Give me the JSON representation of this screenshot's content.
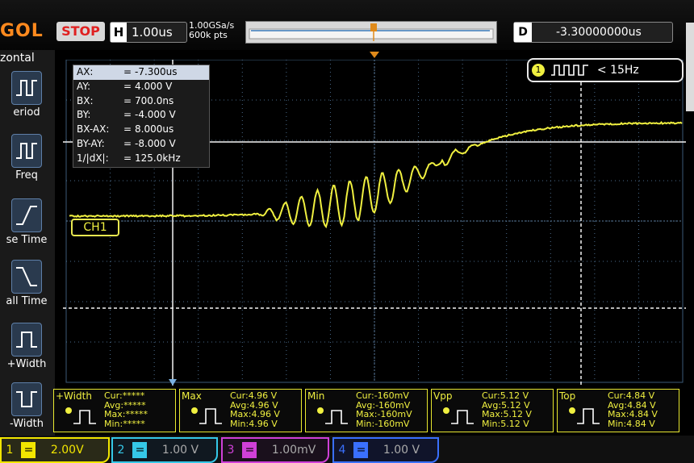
{
  "brand": "GOL",
  "run_state": "STOP",
  "timebase": {
    "label": "H",
    "value": "1.00us"
  },
  "sample": {
    "rate": "1.00GSa/s",
    "points": "600k pts"
  },
  "delay": {
    "label": "D",
    "value": "-3.30000000us"
  },
  "left_menu": {
    "header": "zontal",
    "items": [
      {
        "label": "eriod",
        "icon": "period-icon"
      },
      {
        "label": "Freq",
        "icon": "frequency-icon"
      },
      {
        "label": "se Time",
        "icon": "rise-time-icon"
      },
      {
        "label": "all Time",
        "icon": "fall-time-icon"
      },
      {
        "label": "+Width",
        "icon": "positive-width-icon"
      },
      {
        "label": "-Width",
        "icon": "negative-width-icon"
      }
    ]
  },
  "cursors": [
    {
      "name": "AX:",
      "eq": "=",
      "value": "-7.300us"
    },
    {
      "name": "AY:",
      "eq": "=",
      "value": "4.000 V"
    },
    {
      "name": "BX:",
      "eq": "=",
      "value": "700.0ns"
    },
    {
      "name": "BY:",
      "eq": "=",
      "value": "-4.000 V"
    },
    {
      "name": "BX-AX:",
      "eq": "=",
      "value": "8.000us"
    },
    {
      "name": "BY-AY:",
      "eq": "=",
      "value": "-8.000 V"
    },
    {
      "name": "1/|dX|:",
      "eq": "=",
      "value": "125.0kHz"
    }
  ],
  "trigger_freq": "< 15Hz",
  "channel_marker": "CH1",
  "measurements": [
    {
      "title": "+Width",
      "cur": "Cur:*****",
      "avg": "Avg:*****",
      "max": "Max:*****",
      "min": "Min:*****"
    },
    {
      "title": "Max",
      "cur": "Cur:4.96 V",
      "avg": "Avg:4.96 V",
      "max": "Max:4.96 V",
      "min": "Min:4.96 V"
    },
    {
      "title": "Min",
      "cur": "Cur:-160mV",
      "avg": "Avg:-160mV",
      "max": "Max:-160mV",
      "min": "Min:-160mV"
    },
    {
      "title": "Vpp",
      "cur": "Cur:5.12 V",
      "avg": "Avg:5.12 V",
      "max": "Max:5.12 V",
      "min": "Min:5.12 V"
    },
    {
      "title": "Top",
      "cur": "Cur:4.84 V",
      "avg": "Avg:4.84 V",
      "max": "Max:4.84 V",
      "min": "Min:4.84 V"
    }
  ],
  "channels": [
    {
      "num": "1",
      "eq": "=",
      "scale": "2.00V",
      "color": "#f2e600"
    },
    {
      "num": "2",
      "eq": "=",
      "scale": "1.00 V",
      "color": "#35c8e8"
    },
    {
      "num": "3",
      "eq": "=",
      "scale": "1.00mV",
      "color": "#d040d8"
    },
    {
      "num": "4",
      "eq": "=",
      "scale": "1.00 V",
      "color": "#3a70ff"
    }
  ],
  "colors": {
    "trace": "#f0f040",
    "grid": "#4a6a8a",
    "accent": "#ff8a1e"
  }
}
